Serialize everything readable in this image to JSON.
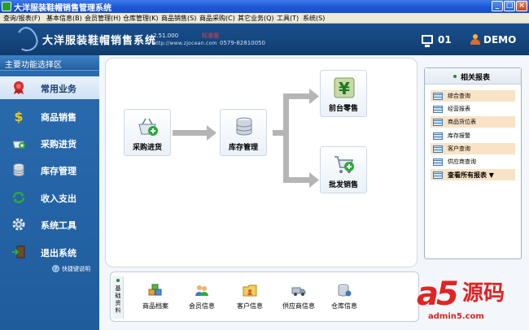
{
  "window": {
    "title": "大洋服装鞋帽销售管理系统",
    "minimize": "_",
    "maximize": "□",
    "close": "×"
  },
  "menu": [
    "查询/报表(F)",
    "基本信息(B)",
    "会员管理(H)",
    "仓库管理(K)",
    "商品销售(S)",
    "商品采购(C)",
    "其它业务(Q)",
    "工具(T)",
    "系统(S)"
  ],
  "banner": {
    "app_name": "大洋服装鞋帽销售系统",
    "version": "2.51.000",
    "edition_tag": "标准版",
    "url": "http://www.zjocean.com",
    "phone": "0579-82810050",
    "station": "01",
    "user": "DEMO"
  },
  "sidebar": {
    "header": "主要功能选择区",
    "items": [
      {
        "label": "常用业务",
        "icon": "ribbon-award-icon",
        "active": true
      },
      {
        "label": "商品销售",
        "icon": "dollar-icon",
        "active": false
      },
      {
        "label": "采购进货",
        "icon": "basket-icon",
        "active": false
      },
      {
        "label": "库存管理",
        "icon": "database-icon",
        "active": false
      },
      {
        "label": "收入支出",
        "icon": "recycle-arrows-icon",
        "active": false
      },
      {
        "label": "系统工具",
        "icon": "gear-icon",
        "active": false
      },
      {
        "label": "退出系统",
        "icon": "exit-door-icon",
        "active": false
      }
    ],
    "help": "快捷键说明"
  },
  "workflow": {
    "purchase": "采购进货",
    "stock": "库存管理",
    "retail": "前台零售",
    "wholesale": "批发销售"
  },
  "reports": {
    "header": "相关报表",
    "items": [
      "综合查询",
      "经营报表",
      "商品货位表",
      "库存报警",
      "客户查询",
      "供应商查询"
    ],
    "more": "查看所有报表 ▼"
  },
  "basedata": {
    "tag": "基础资料",
    "items": [
      {
        "label": "商品档案",
        "icon": "boxes-icon"
      },
      {
        "label": "会员信息",
        "icon": "users-icon"
      },
      {
        "label": "客户信息",
        "icon": "folder-people-icon"
      },
      {
        "label": "供应商信息",
        "icon": "truck-icon"
      },
      {
        "label": "仓库信息",
        "icon": "warehouse-db-icon"
      }
    ]
  },
  "watermark": {
    "logo": "a5",
    "text": "源码",
    "domain": "admin5.com"
  },
  "colors": {
    "title_bar": "#1d56d6",
    "banner": "#15477f",
    "sidebar": "#2a6cb0",
    "report_highlight": "#f9e3c7",
    "watermark": "#e02323"
  }
}
